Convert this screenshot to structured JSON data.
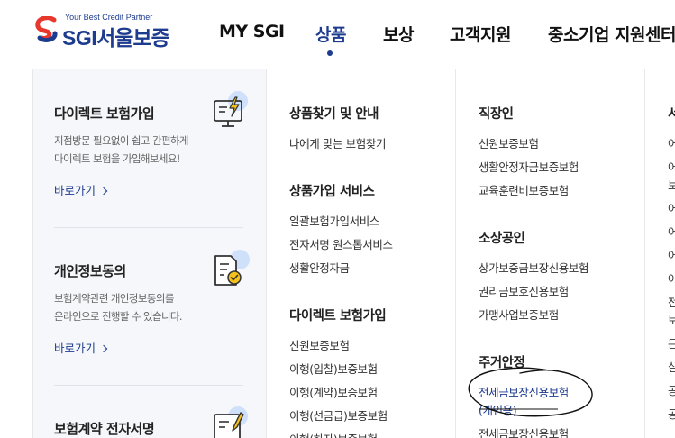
{
  "header": {
    "logo": {
      "tagline": "Your Best Credit Partner",
      "sgi": "SGI",
      "name": "서울보증"
    },
    "nav": [
      {
        "label": "MY SGI"
      },
      {
        "label": "상품"
      },
      {
        "label": "보상"
      },
      {
        "label": "고객지원"
      },
      {
        "label": "중소기업 지원센터"
      }
    ]
  },
  "promos": [
    {
      "title": "다이렉트 보험가입",
      "desc1": "지점방문 필요없이 쉽고 간편하게",
      "desc2": "다이렉트 보험을 가입해보세요!",
      "link": "바로가기",
      "icon": "computer-lightning-icon"
    },
    {
      "title": "개인정보동의",
      "desc1": "보험계약관련 개인정보동의를",
      "desc2": "온라인으로 진행할 수 있습니다.",
      "link": "바로가기",
      "icon": "document-check-icon"
    },
    {
      "title": "보험계약 전자서명",
      "icon": "document-pen-icon"
    }
  ],
  "col1": {
    "sections": [
      {
        "title": "상품찾기 및 안내",
        "links": [
          "나에게 맞는 보험찾기"
        ]
      },
      {
        "title": "상품가입 서비스",
        "links": [
          "일괄보험가입서비스",
          "전자서명 원스톱서비스",
          "생활안정자금"
        ]
      },
      {
        "title": "다이렉트 보험가입",
        "links": [
          "신원보증보험",
          "이행(입찰)보증보험",
          "이행(계약)보증보험",
          "이행(선금급)보증보험",
          "이행(하자)보증보험"
        ]
      }
    ]
  },
  "col2": {
    "sections": [
      {
        "title": "직장인",
        "links": [
          "신원보증보험",
          "생활안정자금보증보험",
          "교육훈련비보증보험"
        ]
      },
      {
        "title": "소상공인",
        "links": [
          "상가보증금보장신용보험",
          "권리금보호신용보험",
          "가맹사업보증보험"
        ]
      },
      {
        "title": "주거안정",
        "links": [
          "전세금보장신용보험",
          "(개인용)",
          "전세금보장신용보험"
        ]
      }
    ]
  },
  "col3": {
    "title": "서",
    "links": [
      "어",
      "어",
      "보",
      "어",
      "어",
      "어",
      "어",
      "전",
      "보",
      "든",
      "실",
      "공",
      "공"
    ]
  },
  "colors": {
    "brand": "#1d3b8f",
    "accent": "#e8372c",
    "icon_bubble": "#cfe0fb",
    "annotation": "#111111"
  }
}
